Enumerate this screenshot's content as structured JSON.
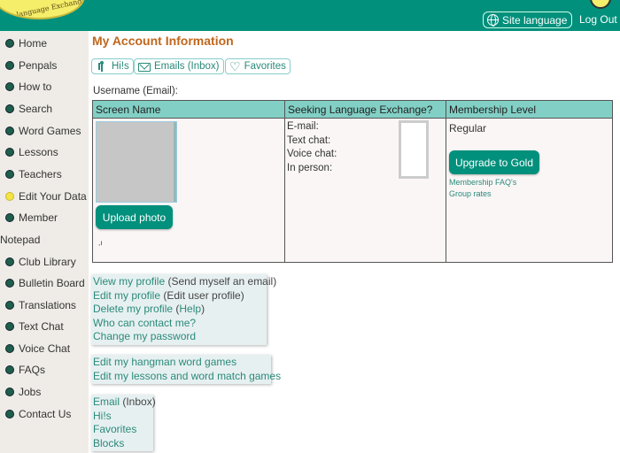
{
  "header": {
    "logo_text": "language Exchange",
    "site_language_label": "Site language",
    "logout_label": "Log Out"
  },
  "sidebar": {
    "items": [
      {
        "label": "Home",
        "dot": "green"
      },
      {
        "label": "Penpals",
        "dot": "green"
      },
      {
        "label": "How to",
        "dot": "green"
      },
      {
        "label": "Search",
        "dot": "green"
      },
      {
        "label": "Word Games",
        "dot": "green"
      },
      {
        "label": "Lessons",
        "dot": "green"
      },
      {
        "label": "Teachers",
        "dot": "green"
      },
      {
        "label": "Edit Your Data",
        "dot": "yellow"
      },
      {
        "label": "Member",
        "dot": "green"
      },
      {
        "label": "Notepad",
        "dot": "none"
      },
      {
        "label": "Club Library",
        "dot": "green"
      },
      {
        "label": "Bulletin Board",
        "dot": "green"
      },
      {
        "label": "Translations",
        "dot": "green"
      },
      {
        "label": "Text Chat",
        "dot": "green"
      },
      {
        "label": "Voice Chat",
        "dot": "green"
      },
      {
        "label": "FAQs",
        "dot": "green"
      },
      {
        "label": "Jobs",
        "dot": "green"
      },
      {
        "label": "Contact Us",
        "dot": "green"
      }
    ]
  },
  "main": {
    "title": "My Account Information",
    "tabs": {
      "his": "Hi!s",
      "email": "Emails (Inbox)",
      "favorites": "Favorites"
    },
    "username_label": "Username (Email):",
    "table": {
      "headers": [
        "Screen Name",
        "Seeking Language Exchange?",
        "Membership Level"
      ],
      "upload_photo": "Upload photo",
      "tiny_mark": ",ı",
      "seeking": {
        "email": "E-mail:",
        "text_chat": "Text chat:",
        "voice_chat": "Voice chat:",
        "in_person": "In person:"
      },
      "membership": {
        "level": "Regular",
        "upgrade_button": "Upgrade to Gold",
        "faq_link": "Membership FAQ's",
        "group_rates_link": "Group rates"
      }
    },
    "profile_links": {
      "view_profile": "View my profile",
      "view_profile_note": " (Send myself an email)",
      "edit_profile": "Edit my profile",
      "edit_profile_note": " (Edit user profile)",
      "delete_profile": "Delete my profile",
      "delete_help_open": " (",
      "delete_help": "Help",
      "delete_help_close": ")",
      "who_contact": "Who can contact me?",
      "change_password": "Change my password"
    },
    "game_links": {
      "hangman": "Edit my hangman word games",
      "lessons": "Edit my lessons and word match games"
    },
    "mail_links": {
      "email": "Email",
      "inbox_note": " (Inbox)",
      "his": "Hi!s",
      "favorites": "Favorites",
      "blocks": "Blocks"
    }
  },
  "colors": {
    "header_bg": "#00907c",
    "sidebar_bg": "#efece7",
    "title": "#c0661c",
    "table_header": "#82cfc5",
    "link": "#2a8a7a",
    "button": "#00907c"
  }
}
